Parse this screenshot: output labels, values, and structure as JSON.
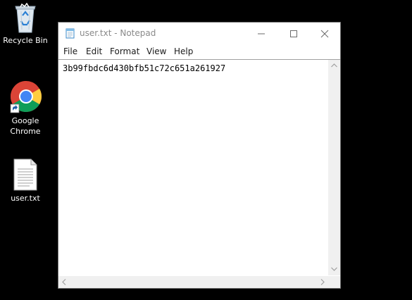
{
  "desktop": {
    "icons": [
      {
        "label": "Recycle Bin",
        "icon": "recycle-bin-icon"
      },
      {
        "label": "Google Chrome",
        "icon": "chrome-icon"
      },
      {
        "label": "user.txt",
        "icon": "text-file-icon"
      }
    ]
  },
  "window": {
    "title": "user.txt - Notepad",
    "menu": [
      "File",
      "Edit",
      "Format",
      "View",
      "Help"
    ],
    "content": "3b99fbdc6d430bfb51c72c651a261927"
  },
  "colors": {
    "desktop_background": "#000000",
    "window_background": "#ffffff",
    "title_text": "#8a8a8a",
    "scrollbar": "#f0f0f0"
  }
}
